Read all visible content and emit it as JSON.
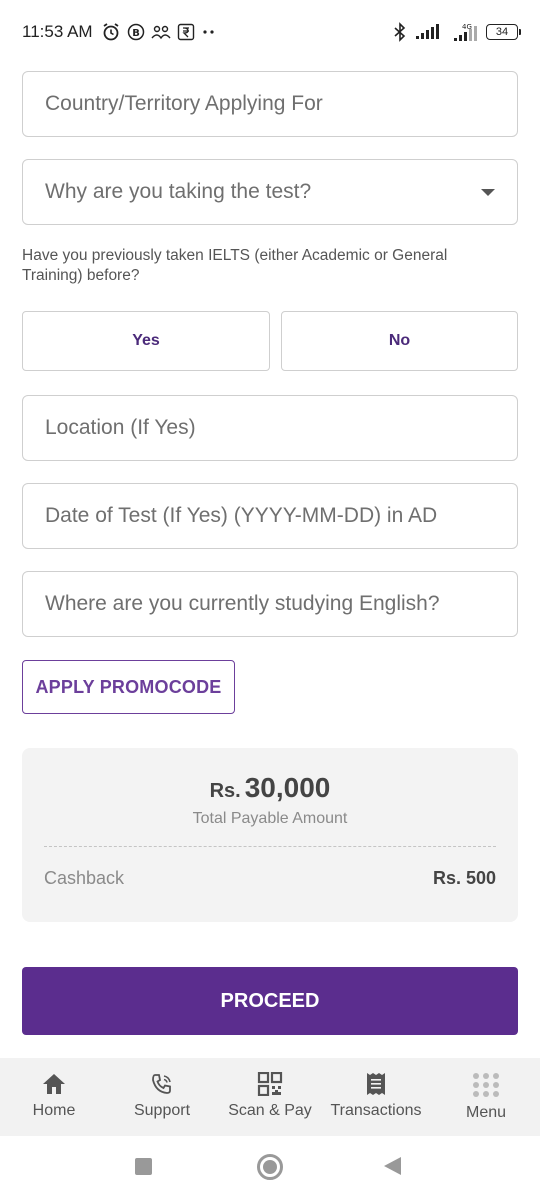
{
  "status_bar": {
    "time": "11:53 AM",
    "battery": "34",
    "network_label": "4G"
  },
  "form": {
    "country_placeholder": "Country/Territory Applying For",
    "reason_placeholder": "Why are you taking the test?",
    "previous_question": "Have you previously taken IELTS (either Academic or General Training) before?",
    "yes_label": "Yes",
    "no_label": "No",
    "location_placeholder": "Location (If Yes)",
    "date_placeholder": "Date of Test (If Yes) (YYYY-MM-DD) in AD",
    "studying_placeholder": "Where are you currently studying English?"
  },
  "promo": {
    "label": "APPLY PROMOCODE"
  },
  "summary": {
    "currency": "Rs.",
    "amount": "30,000",
    "amount_label": "Total Payable Amount",
    "cashback_label": "Cashback",
    "cashback_value": "Rs. 500"
  },
  "proceed_label": "PROCEED",
  "bottom_nav": {
    "items": [
      {
        "label": "Home",
        "icon": "home-icon"
      },
      {
        "label": "Support",
        "icon": "phone-icon"
      },
      {
        "label": "Scan & Pay",
        "icon": "qr-icon"
      },
      {
        "label": "Transactions",
        "icon": "receipt-icon"
      },
      {
        "label": "Menu",
        "icon": "grid-menu-icon"
      }
    ]
  },
  "colors": {
    "brand": "#5b2d8e",
    "accent_text": "#6c3f9b",
    "card_bg": "#f3f3f3",
    "nav_bg": "#f2f2f2"
  }
}
